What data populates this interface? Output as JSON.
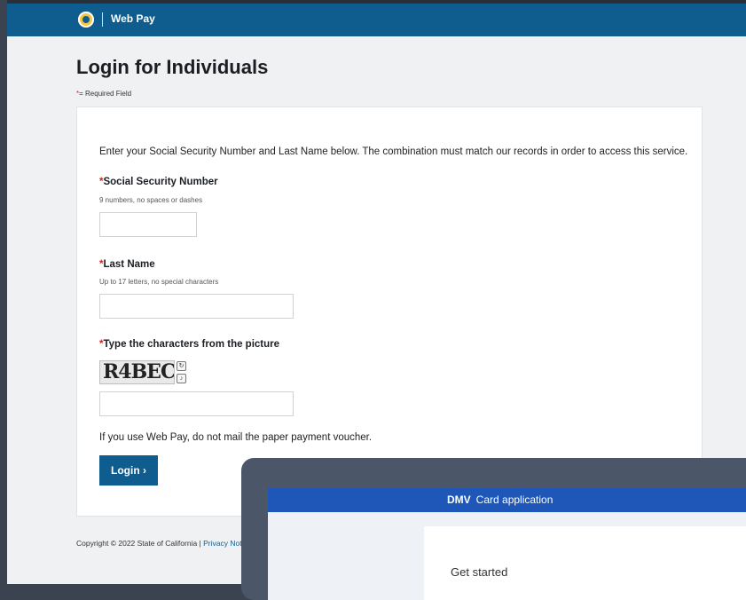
{
  "header": {
    "brand": "Web Pay",
    "logo_icon": "seal-logo-icon"
  },
  "page": {
    "title": "Login for Individuals",
    "required_note": "= Required Field"
  },
  "form": {
    "intro": "Enter your Social Security Number and Last Name below. The combination must match our records in order to access this service.",
    "ssn": {
      "label": "Social Security Number",
      "hint": "9 numbers, no spaces or dashes",
      "value": ""
    },
    "last_name": {
      "label": "Last Name",
      "hint": "Up to 17 letters, no special characters",
      "value": ""
    },
    "captcha": {
      "label": "Type the characters from the picture",
      "image_text": "R4BEC",
      "refresh_icon": "refresh-icon",
      "audio_icon": "audio-icon",
      "value": ""
    },
    "note": "If you use Web Pay, do not mail the paper payment voucher.",
    "login_label": "Login",
    "login_icon": "chevron-right-icon"
  },
  "footer": {
    "copyright": "Copyright © 2022 State of California | ",
    "privacy_link": "Privacy Notice"
  },
  "overlay": {
    "brand": "DMV",
    "title": "Card application",
    "card_text": "Get started"
  },
  "colors": {
    "header": "#0f5d8e",
    "required": "#d81e1e",
    "overlay_bar": "#1e57b8"
  }
}
